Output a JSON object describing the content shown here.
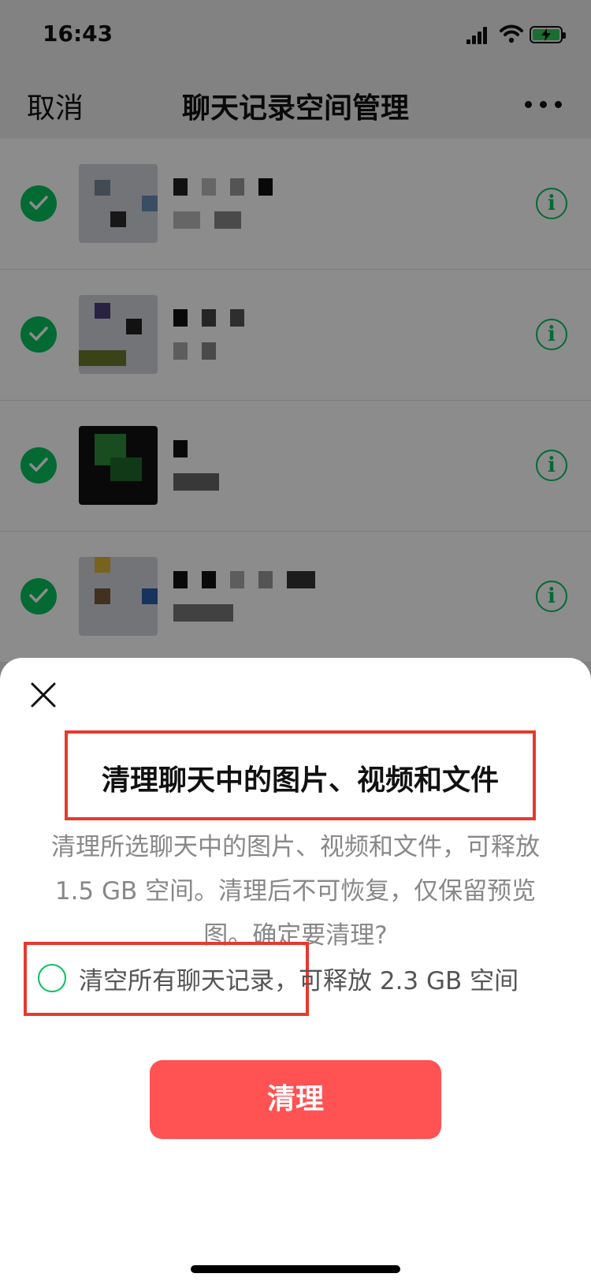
{
  "status_bar": {
    "time": "16:43"
  },
  "nav": {
    "cancel": "取消",
    "title": "聊天记录空间管理",
    "more_icon": "more-icon"
  },
  "chat_list": [
    {
      "checked": true
    },
    {
      "checked": true
    },
    {
      "checked": true
    },
    {
      "checked": true
    }
  ],
  "sheet": {
    "close_icon": "close-icon",
    "title": "清理聊天中的图片、视频和文件",
    "description": "清理所选聊天中的图片、视频和文件，可释放 1.5 GB 空间。清理后不可恢复，仅保留预览图。确定要清理?",
    "option_label": "清空所有聊天记录，可释放 2.3 GB 空间",
    "option_checked": false,
    "button": "清理"
  },
  "colors": {
    "accent": "#07c160",
    "danger": "#ff5252",
    "highlight": "#e53a2e"
  }
}
